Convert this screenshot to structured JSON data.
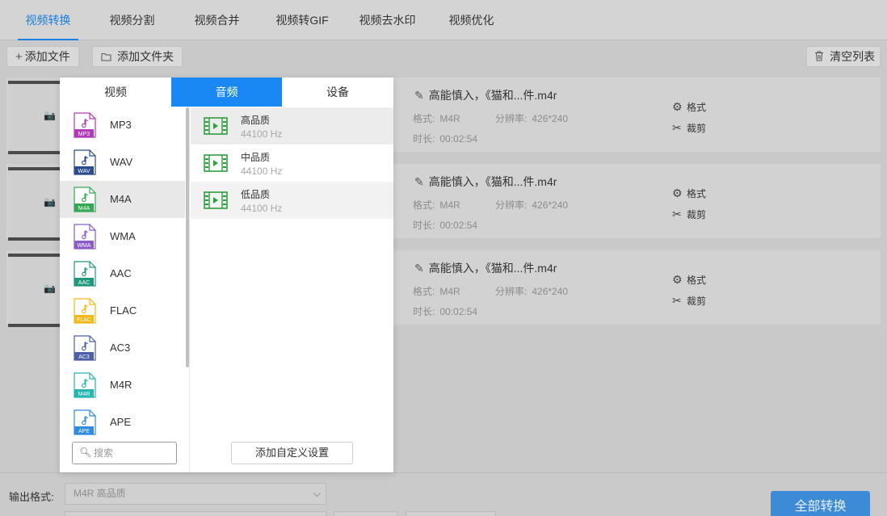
{
  "colors": {
    "accent": "#1a7fe0",
    "panel_tab_active": "#1a88f4",
    "quality_icon": "#2e9e3f",
    "convert_button": "#3d8ad6"
  },
  "top_tabs": [
    {
      "label": "视频转换",
      "active": true
    },
    {
      "label": "视频分割",
      "active": false
    },
    {
      "label": "视频合并",
      "active": false
    },
    {
      "label": "视频转GIF",
      "active": false
    },
    {
      "label": "视频去水印",
      "active": false
    },
    {
      "label": "视频优化",
      "active": false
    }
  ],
  "toolbar": {
    "add_file_label": "添加文件",
    "add_folder_label": "添加文件夹",
    "clear_list_label": "清空列表",
    "add_file_icon": "plus-icon",
    "add_folder_icon": "folder-icon",
    "clear_list_icon": "trash-icon"
  },
  "files": [
    {
      "name": "高能慎入，《猫和...件.m4r",
      "format_label": "格式:",
      "format": "M4R",
      "resolution_label": "分辨率:",
      "resolution": "426*240",
      "duration_label": "时长:",
      "duration": "00:02:54",
      "format_action": "格式",
      "crop_action": "裁剪"
    },
    {
      "name": "高能慎入，《猫和...件.m4r",
      "format_label": "格式:",
      "format": "M4R",
      "resolution_label": "分辨率:",
      "resolution": "426*240",
      "duration_label": "时长:",
      "duration": "00:02:54",
      "format_action": "格式",
      "crop_action": "裁剪"
    },
    {
      "name": "高能慎入，《猫和...件.m4r",
      "format_label": "格式:",
      "format": "M4R",
      "resolution_label": "分辨率:",
      "resolution": "426*240",
      "duration_label": "时长:",
      "duration": "00:02:54",
      "format_action": "格式",
      "crop_action": "裁剪"
    }
  ],
  "dropdown": {
    "tabs": [
      {
        "label": "视频",
        "active": false
      },
      {
        "label": "音频",
        "active": true
      },
      {
        "label": "设备",
        "active": false
      }
    ],
    "formats": [
      {
        "label": "MP3",
        "badge": "MP3",
        "color": "#b23ab8",
        "selected": false
      },
      {
        "label": "WAV",
        "badge": "WAV",
        "color": "#2b4a8c",
        "selected": false
      },
      {
        "label": "M4A",
        "badge": "M4A",
        "color": "#34a853",
        "selected": true
      },
      {
        "label": "WMA",
        "badge": "WMA",
        "color": "#8a5cc9",
        "selected": false
      },
      {
        "label": "AAC",
        "badge": "AAC",
        "color": "#1e9a7a",
        "selected": false
      },
      {
        "label": "FLAC",
        "badge": "FLAC",
        "color": "#f2b81a",
        "selected": false
      },
      {
        "label": "AC3",
        "badge": "AC3",
        "color": "#4a5fa8",
        "selected": false
      },
      {
        "label": "M4R",
        "badge": "M4R",
        "color": "#26b5b0",
        "selected": false
      },
      {
        "label": "APE",
        "badge": "APE",
        "color": "#2f8be0",
        "selected": false
      }
    ],
    "qualities": [
      {
        "name": "高品质",
        "hz": "44100 Hz",
        "selected": true
      },
      {
        "name": "中品质",
        "hz": "44100 Hz",
        "selected": false
      },
      {
        "name": "低品质",
        "hz": "44100 Hz",
        "selected": false
      }
    ],
    "search_placeholder": "搜索",
    "custom_button_label": "添加自定义设置"
  },
  "bottom": {
    "output_label": "输出格式:",
    "output_value": "M4R  高品质",
    "convert_all_label": "全部转换"
  }
}
